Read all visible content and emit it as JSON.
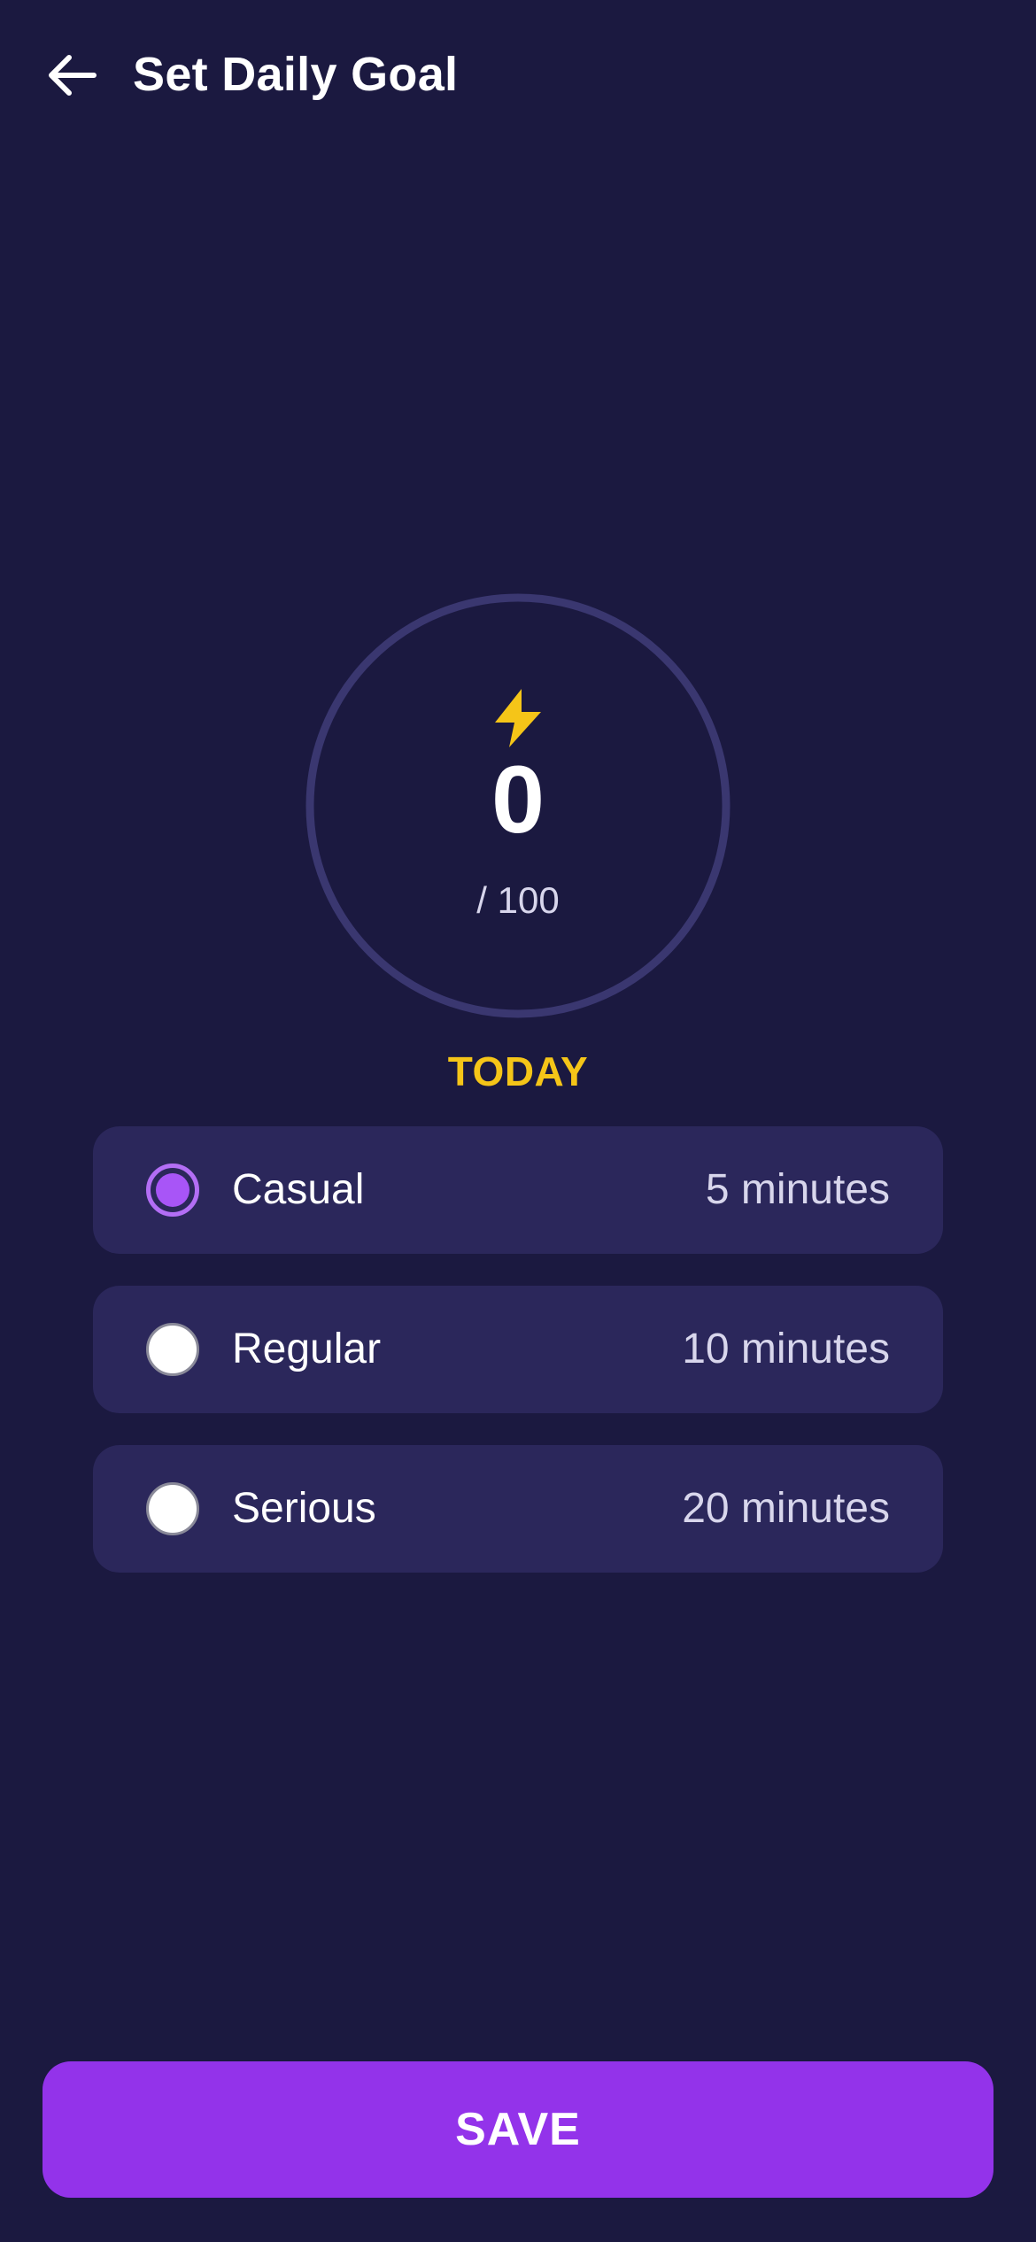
{
  "header": {
    "title": "Set Daily Goal",
    "back_icon": "arrow-left-icon"
  },
  "progress": {
    "icon": "lightning-bolt-icon",
    "current": "0",
    "total_label": "/ 100",
    "value": 0,
    "max": 100,
    "ring_color": "#3a3770",
    "bolt_color": "#f5c518"
  },
  "today_label": "TODAY",
  "options": [
    {
      "label": "Casual",
      "time": "5 minutes",
      "selected": true
    },
    {
      "label": "Regular",
      "time": "10 minutes",
      "selected": false
    },
    {
      "label": "Serious",
      "time": "20 minutes",
      "selected": false
    }
  ],
  "save_label": "SAVE",
  "colors": {
    "background": "#1b1940",
    "card": "#2b275b",
    "accent": "#9333ea",
    "highlight": "#f5c518"
  }
}
